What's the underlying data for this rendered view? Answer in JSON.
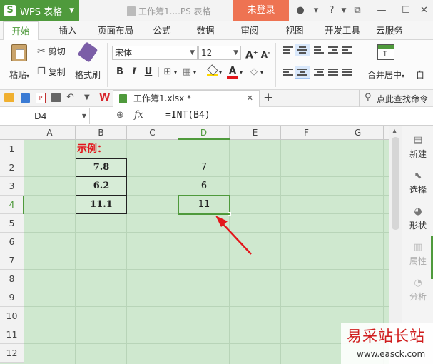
{
  "titlebar": {
    "app_logo": "S",
    "app_name": "WPS 表格",
    "doc_title": "工作簿1....PS 表格",
    "login": "未登录"
  },
  "menu": {
    "tabs": [
      "开始",
      "插入",
      "页面布局",
      "公式",
      "数据",
      "审阅",
      "视图",
      "开发工具",
      "云服务"
    ],
    "active_index": 0
  },
  "ribbon": {
    "paste": "粘贴",
    "cut": "剪切",
    "copy": "复制",
    "format_painter": "格式刷",
    "font_name": "宋体",
    "font_size": "12",
    "bold": "B",
    "italic": "I",
    "underline": "U",
    "font_color_letter": "A",
    "merge_center": "合并居中",
    "auto_wrap": "自"
  },
  "quickbar": {
    "file_tab": "工作簿1.xlsx *",
    "search": "点此查找命令"
  },
  "formulabar": {
    "cell_ref": "D4",
    "fx": "fx",
    "formula": "=INT(B4)"
  },
  "sheet": {
    "columns": [
      "A",
      "B",
      "C",
      "D",
      "E",
      "F",
      "G"
    ],
    "rows": [
      "1",
      "2",
      "3",
      "4",
      "5",
      "6",
      "7",
      "8",
      "9",
      "10",
      "11",
      "12"
    ],
    "example_label": "示例：",
    "b_values": [
      "7.8",
      "6.2",
      "11.1"
    ],
    "d_values": [
      "7",
      "6",
      "11"
    ]
  },
  "sidebar": {
    "items": [
      "新建",
      "选择",
      "形状",
      "属性",
      "分析"
    ]
  },
  "watermark": {
    "title": "易采站长站",
    "url": "www.easck.com"
  },
  "colors": {
    "wps_green": "#4f9a3c",
    "login_orange": "#ee7352",
    "grid_bg": "#cfe8cf",
    "annotation_red": "#e3161b"
  }
}
